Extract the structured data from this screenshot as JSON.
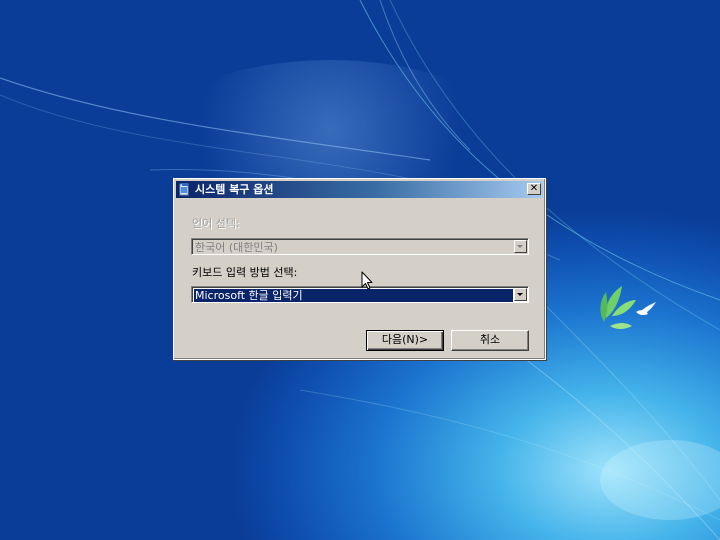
{
  "dialog": {
    "title": "시스템 복구 옵션",
    "close_label": "✕",
    "language_label": "언어 선택:",
    "language_value": "한국어 (대한민국)",
    "keyboard_label": "키보드 입력 방법 선택:",
    "keyboard_value": "Microsoft 한글 입력기",
    "next_button": "다음(N)>",
    "cancel_button": "취소"
  },
  "icons": [
    "window-icon",
    "close-icon",
    "dropdown-arrow-icon",
    "mouse-cursor-icon",
    "bird-logo-icon"
  ],
  "colors": {
    "dialog_bg": "#d4d0c8",
    "titlebar_start": "#0a246a",
    "titlebar_end": "#a6caf0",
    "selection": "#0a246a",
    "desktop_deep": "#0a3d98",
    "desktop_glow": "#9fe3fb"
  }
}
